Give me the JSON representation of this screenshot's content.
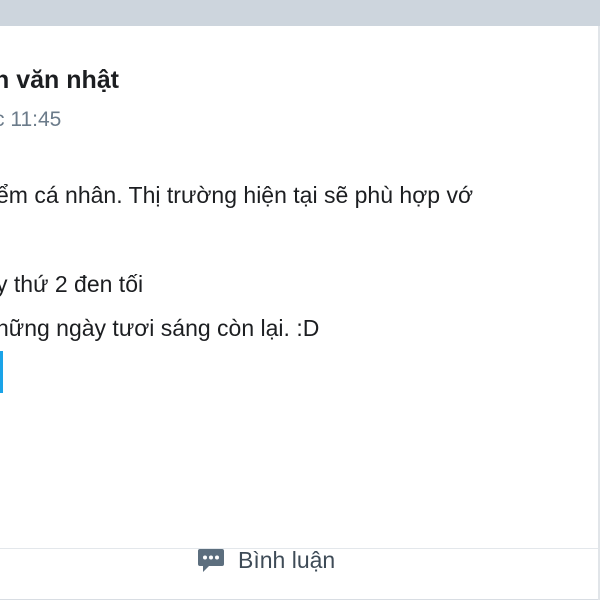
{
  "post": {
    "author": "n văn nhật",
    "time": "c 11:45",
    "lines": [
      "ểm cá nhân. Thị trường hiện tại sẽ phù hợp vớ",
      "y thứ 2 đen tối",
      "hững ngày tươi sáng còn lại. :D"
    ]
  },
  "actions": {
    "comment_label": "Bình luận",
    "comment_icon": "comment-icon"
  },
  "colors": {
    "accent": "#1aa3e8",
    "background": "#e9ebee",
    "card": "#ffffff",
    "icon": "#5c6e7e"
  }
}
